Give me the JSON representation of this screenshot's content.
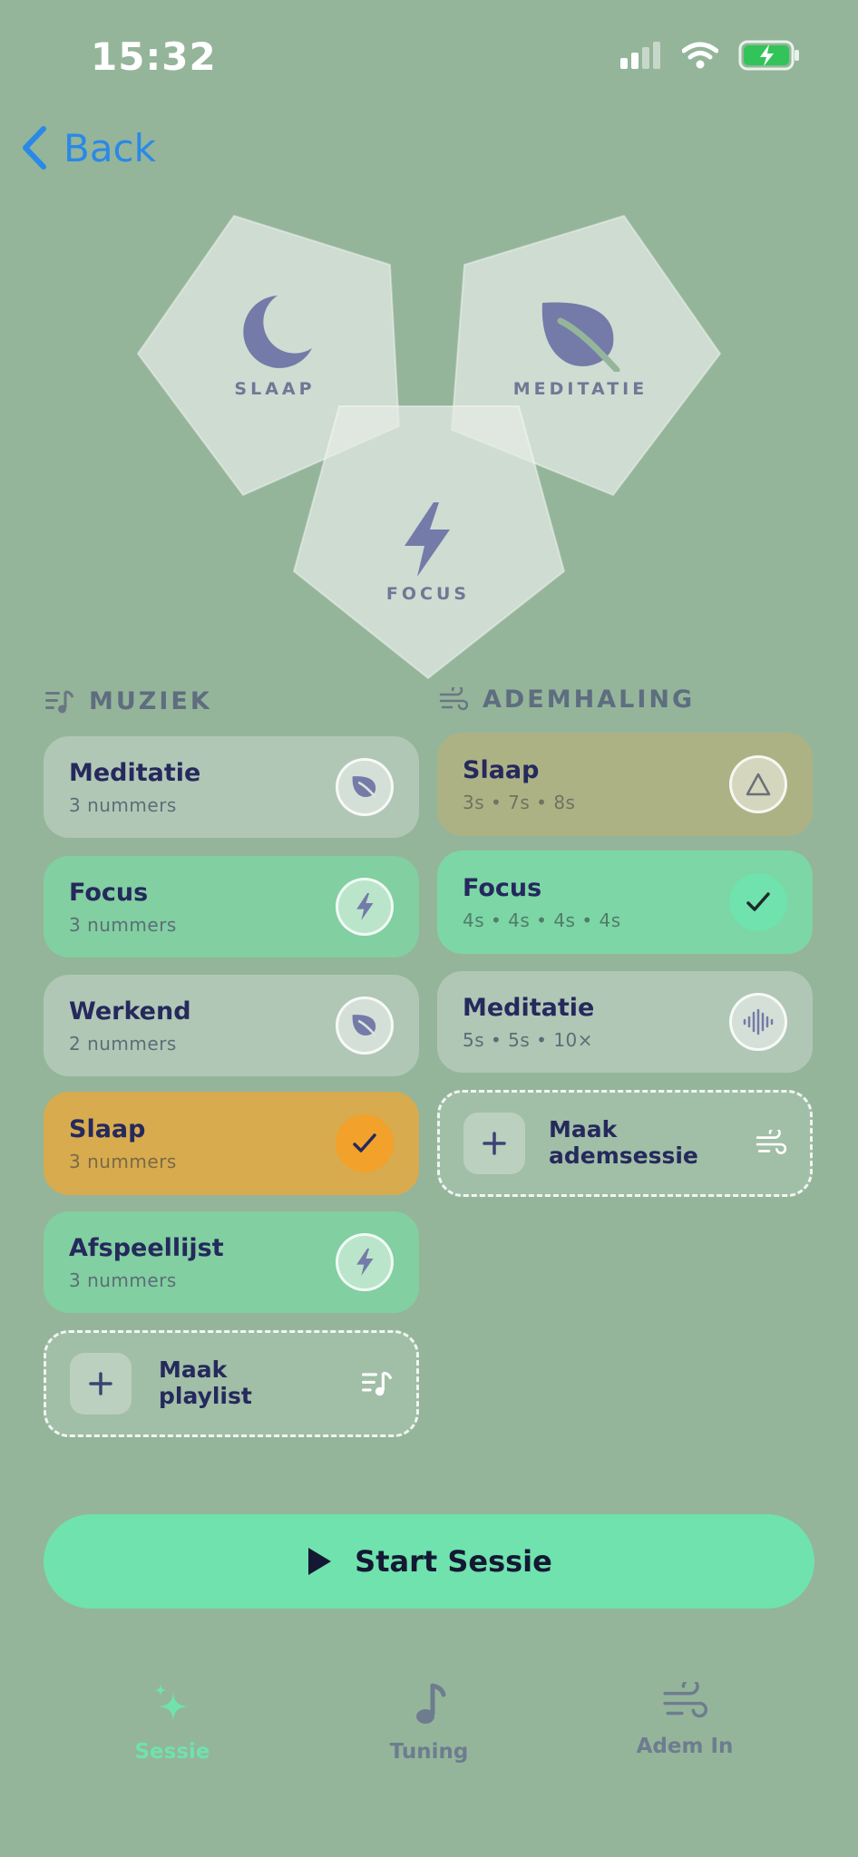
{
  "status_bar": {
    "time": "15:32"
  },
  "nav": {
    "back_label": "Back"
  },
  "categories": [
    {
      "label": "SLAAP",
      "icon": "moon-icon"
    },
    {
      "label": "MEDITATIE",
      "icon": "leaf-icon"
    },
    {
      "label": "FOCUS",
      "icon": "bolt-icon"
    }
  ],
  "music": {
    "header": "MUZIEK",
    "items": [
      {
        "title": "Meditatie",
        "subtitle": "3 nummers",
        "icon": "leaf-icon",
        "selected": false
      },
      {
        "title": "Focus",
        "subtitle": "3 nummers",
        "icon": "bolt-icon",
        "selected": false
      },
      {
        "title": "Werkend",
        "subtitle": "2 nummers",
        "icon": "leaf-icon",
        "selected": false
      },
      {
        "title": "Slaap",
        "subtitle": "3 nummers",
        "icon": "check-icon",
        "selected": true
      },
      {
        "title": "Afspeellijst",
        "subtitle": "3 nummers",
        "icon": "bolt-icon",
        "selected": false
      }
    ],
    "create_line1": "Maak",
    "create_line2": "playlist"
  },
  "breathing": {
    "header": "ADEMHALING",
    "items": [
      {
        "title": "Slaap",
        "subtitle": "3s • 7s • 8s",
        "icon": "triangle-icon",
        "selected": false
      },
      {
        "title": "Focus",
        "subtitle": "4s • 4s • 4s • 4s",
        "icon": "check-icon",
        "selected": true
      },
      {
        "title": "Meditatie",
        "subtitle": "5s • 5s • 10×",
        "icon": "waveform-icon",
        "selected": false
      }
    ],
    "create_line1": "Maak",
    "create_line2": "ademsessie"
  },
  "start_button": {
    "label": "Start Sessie"
  },
  "tabs": [
    {
      "label": "Sessie",
      "icon": "sparkles-icon",
      "active": true
    },
    {
      "label": "Tuning",
      "icon": "music-note-icon",
      "active": false
    },
    {
      "label": "Adem In",
      "icon": "wind-icon",
      "active": false
    }
  ],
  "colors": {
    "background": "#94b59a",
    "accent_mint": "#6fe2ae",
    "selected_orange": "#f2a12a",
    "text_navy": "#25295c",
    "back_blue": "#2a89e8"
  }
}
